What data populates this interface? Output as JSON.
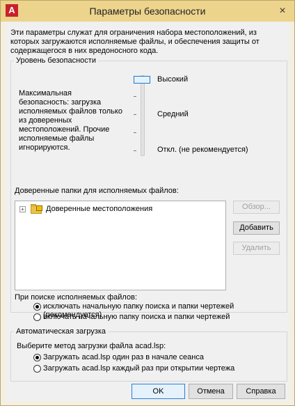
{
  "window": {
    "title": "Параметры безопасности",
    "app_icon": "A",
    "close_glyph": "×"
  },
  "intro_text": "Эти параметры служат для ограничения набора местоположений, из которых загружаются исполняемые файлы, и обеспечения защиты от содержащегося в них вредоносного кода.",
  "security_level": {
    "group_label": "Уровень безопасности",
    "description": "Максимальная безопасность: загрузка исполняемых файлов только из доверенных местоположений. Прочие исполняемые файлы игнорируются.",
    "levels": [
      "Высокий",
      "Средний",
      "Откл. (не рекомендуется)"
    ],
    "selected": "Высокий"
  },
  "trusted_folders": {
    "label": "Доверенные папки для исполняемых файлов:",
    "tree_item": "Доверенные местоположения",
    "browse_button": "Обзор...",
    "add_button": "Добавить",
    "remove_button": "Удалить"
  },
  "search": {
    "label": "При поиске исполняемых файлов:",
    "options": [
      "исключать начальную папку поиска и папки чертежей (рекомендуется)",
      "включать начальную папку поиска и папки чертежей"
    ],
    "selected_index": 0
  },
  "autoload": {
    "group_label": "Автоматическая загрузка",
    "prompt": "Выберите метод загрузки файла acad.lsp:",
    "options": [
      "Загружать acad.lsp один раз в начале сеанса",
      "Загружать acad.lsp каждый раз при открытии чертежа"
    ],
    "selected_index": 0
  },
  "footer": {
    "ok": "OK",
    "cancel": "Отмена",
    "help": "Справка"
  }
}
